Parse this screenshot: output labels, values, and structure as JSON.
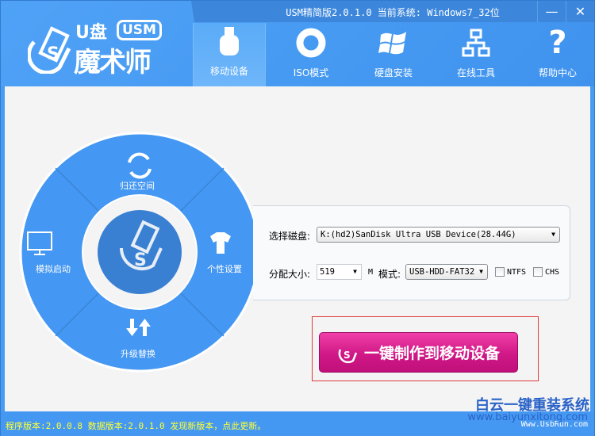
{
  "window": {
    "title": "USM精简版2.0.1.0 当前系统: Windows7_32位",
    "minimize": "—",
    "close": "✕"
  },
  "logo": {
    "u": "U盘",
    "usm": "USM",
    "main": "魔术师"
  },
  "nav": [
    {
      "label": "移动设备",
      "icon": "usb-drive-icon",
      "active": true
    },
    {
      "label": "ISO模式",
      "icon": "disc-icon"
    },
    {
      "label": "硬盘安装",
      "icon": "windows-icon"
    },
    {
      "label": "在线工具",
      "icon": "network-icon"
    },
    {
      "label": "帮助中心",
      "icon": "question-icon"
    }
  ],
  "wheel": {
    "top": "归还空间",
    "right": "个性设置",
    "bottom": "升级替换",
    "left": "模拟启动"
  },
  "form": {
    "disk_label": "选择磁盘:",
    "disk_value": "K:(hd2)SanDisk Ultra USB Device(28.44G)",
    "size_label": "分配大小:",
    "size_value": "519",
    "size_unit": "M",
    "mode_label": "模式:",
    "mode_value": "USB-HDD-FAT32",
    "ntfs": "NTFS",
    "ntfs_checked": false,
    "chs": "CHS",
    "chs_checked": false
  },
  "make_button": "一键制作到移动设备",
  "watermark": {
    "brand": "白云一键重装系统",
    "url": "www.baiyunxitong.com",
    "url2": "Www.UsbRun.com"
  },
  "status": {
    "text": "程序版本:2.0.0.8  数据版本:2.0.1.0 发现新版本，点此更新。"
  },
  "colors": {
    "header": "#4a9cf2",
    "button": "#d01886",
    "status_text": "#ffff33"
  }
}
